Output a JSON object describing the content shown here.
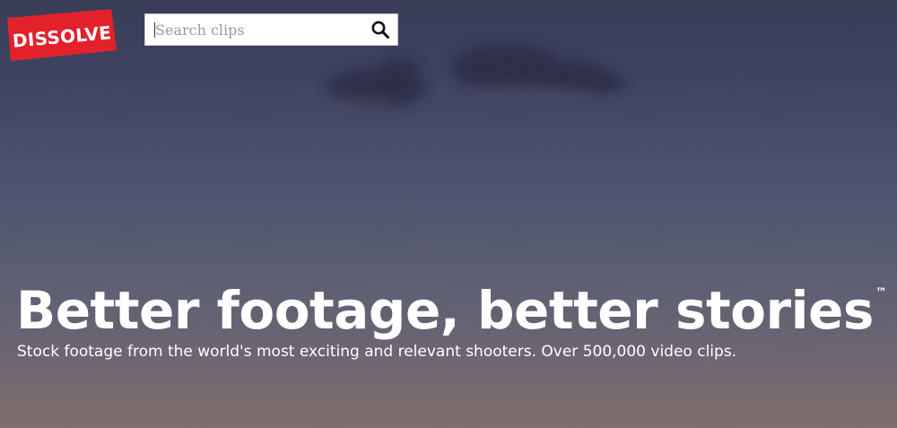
{
  "brand": {
    "logo_text": "DISSOLVE",
    "logo_color": "#e3212b"
  },
  "search": {
    "placeholder": "Search clips",
    "icon": "search-icon"
  },
  "hero": {
    "headline": "Better footage, better stories",
    "trademark": "™",
    "subheadline": "Stock footage from the world's most exciting and relevant shooters. Over 500,000 video clips."
  }
}
